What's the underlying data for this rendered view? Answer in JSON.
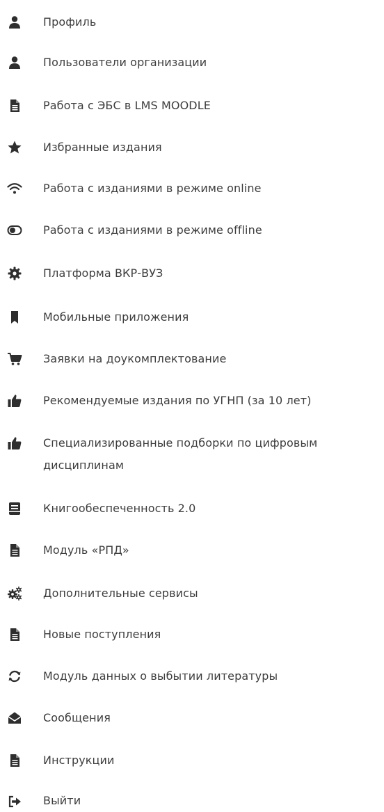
{
  "menu": {
    "items": [
      {
        "label": "Профиль",
        "icon": "user-icon"
      },
      {
        "label": "Пользователи организации",
        "icon": "user-icon"
      },
      {
        "label": "Работа с ЭБС в LMS MOODLE",
        "icon": "document-icon"
      },
      {
        "label": "Избранные издания",
        "icon": "star-icon"
      },
      {
        "label": "Работа с изданиями в режиме online",
        "icon": "wifi-icon"
      },
      {
        "label": "Работа с изданиями в режиме offline",
        "icon": "toggle-icon"
      },
      {
        "label": "Платформа ВКР-ВУЗ",
        "icon": "gear-icon"
      },
      {
        "label": "Мобильные приложения",
        "icon": "bookmark-icon"
      },
      {
        "label": "Заявки на доукомплектование",
        "icon": "cart-icon"
      },
      {
        "label": "Рекомендуемые издания по УГНП (за 10 лет)",
        "icon": "thumbs-up-icon"
      },
      {
        "label": "Специализированные подборки по цифровым дисциплинам",
        "icon": "thumbs-up-icon"
      },
      {
        "label": "Книгообеспеченность 2.0",
        "icon": "book-icon"
      },
      {
        "label": "Модуль «РПД»",
        "icon": "document-icon"
      },
      {
        "label": "Дополнительные сервисы",
        "icon": "gears-icon"
      },
      {
        "label": "Новые поступления",
        "icon": "document-icon"
      },
      {
        "label": "Модуль данных о выбытии литературы",
        "icon": "refresh-icon"
      },
      {
        "label": "Сообщения",
        "icon": "envelope-open-icon"
      },
      {
        "label": "Инструкции",
        "icon": "document-icon"
      },
      {
        "label": "Выйти",
        "icon": "sign-out-icon"
      }
    ]
  },
  "colors": {
    "text": "#3d3d3d",
    "icon": "#2e2e2e",
    "background": "#ffffff"
  }
}
